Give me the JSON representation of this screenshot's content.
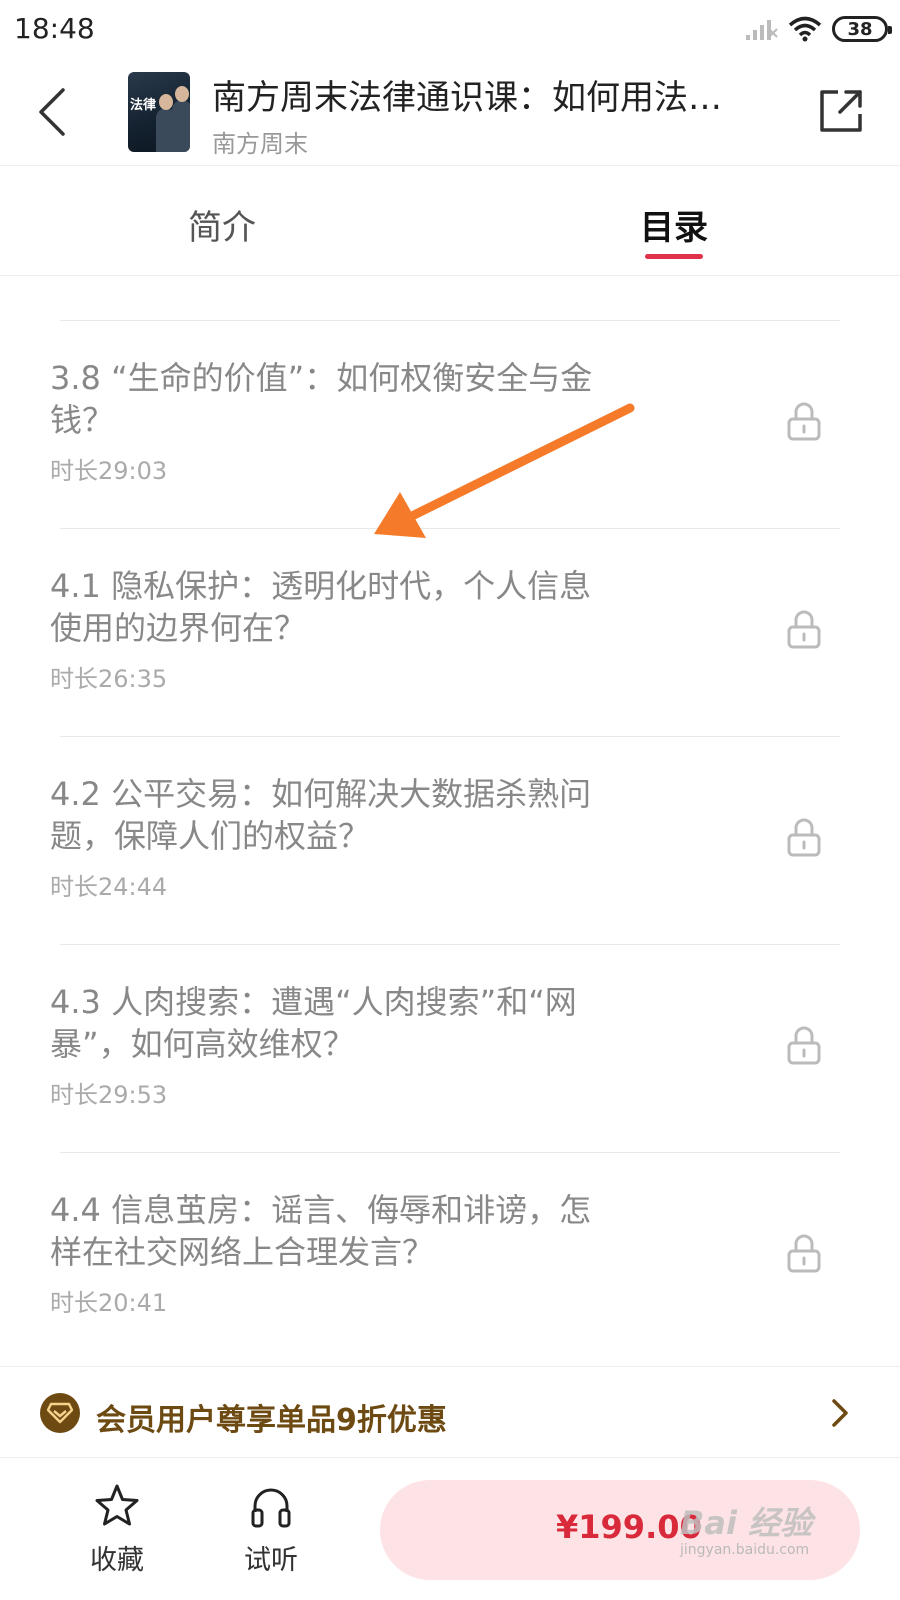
{
  "status_bar": {
    "time": "18:48",
    "battery": "38",
    "icons": [
      "signal-icon",
      "wifi-icon",
      "battery-icon"
    ]
  },
  "header": {
    "course_title": "南方周末法律通识课：如何用法…",
    "author": "南方周末",
    "cover_label": "法律"
  },
  "tabs": [
    {
      "label": "简介",
      "active": false
    },
    {
      "label": "目录",
      "active": true
    }
  ],
  "lessons": [
    {
      "title": "3.8 “生命的价值”：如何权衡安全与金钱？",
      "duration": "时长29:03",
      "locked": true
    },
    {
      "title": "4.1 隐私保护：透明化时代，个人信息使用的边界何在？",
      "duration": "时长26:35",
      "locked": true
    },
    {
      "title": "4.2 公平交易：如何解决大数据杀熟问题，保障人们的权益？",
      "duration": "时长24:44",
      "locked": true
    },
    {
      "title": "4.3 人肉搜索：遭遇“人肉搜索”和“网暴”，如何高效维权？",
      "duration": "时长29:53",
      "locked": true
    },
    {
      "title": "4.4 信息茧房：谣言、侮辱和诽谤，怎样在社交网络上合理发言？",
      "duration": "时长20:41",
      "locked": true
    }
  ],
  "member_bar": {
    "text": "会员用户尊享单品9折优惠"
  },
  "bottom_bar": {
    "favorite_label": "收藏",
    "listen_label": "试听",
    "price": "¥199.00"
  },
  "watermark": {
    "text": "Bai 经验",
    "sub": "jingyan.baidu.com"
  },
  "colors": {
    "accent": "#e0334b",
    "price": "#d92a3c",
    "buy_bg": "#fde3e5",
    "member_gold": "#6d4a12",
    "arrow": "#f57b2a"
  }
}
